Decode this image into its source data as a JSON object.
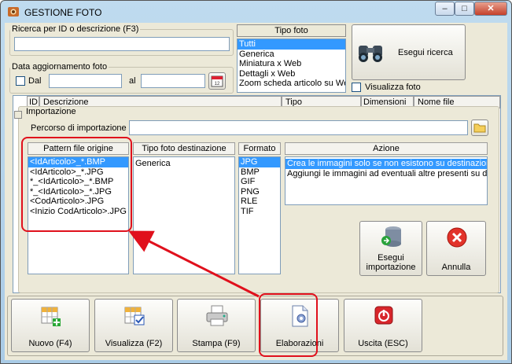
{
  "window": {
    "title": "GESTIONE FOTO",
    "controls": {
      "minimize": "–",
      "maximize": "□",
      "close": "✕"
    }
  },
  "search": {
    "legend": "Ricerca per ID o descrizione (F3)",
    "value": ""
  },
  "date": {
    "legend": "Data aggiornamento foto",
    "from_label": "Dal",
    "to_label": "al",
    "from_value": "",
    "to_value": ""
  },
  "tipo_foto": {
    "label": "Tipo foto",
    "items": [
      "Tutti",
      "Generica",
      "Miniatura x Web",
      "Dettagli x Web",
      "Zoom scheda articolo su Web"
    ],
    "selected": 0
  },
  "esegui_ricerca": {
    "label": "Esegui ricerca"
  },
  "visualizza_foto": {
    "label": "Visualizza foto",
    "checked": false
  },
  "grid_headers": [
    "ID",
    "Descrizione",
    "Tipo",
    "Dimensioni",
    "Nome file"
  ],
  "importazione": {
    "legend": "Importazione",
    "path_label": "Percorso di importazione :",
    "path_value": "",
    "pattern": {
      "header": "Pattern file origine",
      "items": [
        "<IdArticolo>_*.BMP",
        "<IdArticolo>_*.JPG",
        "*_<IdArticolo>_*.BMP",
        "*_<IdArticolo>_*.JPG",
        "<CodArticolo>.JPG",
        "<Inizio CodArticolo>.JPG"
      ],
      "selected": 0
    },
    "tipo_dest": {
      "header": "Tipo foto destinazione",
      "items": [
        "Generica"
      ]
    },
    "formato": {
      "header": "Formato",
      "items": [
        "JPG",
        "BMP",
        "GIF",
        "PNG",
        "RLE",
        "TIF"
      ],
      "selected": 0
    },
    "azione": {
      "header": "Azione",
      "items": [
        "Crea le immagini solo se non esistono su destinazione",
        "Aggiungi le immagini ad eventuali altre presenti su destinazione"
      ],
      "selected": 0
    },
    "esegui_importazione": {
      "label1": "Esegui",
      "label2": "importazione"
    },
    "annulla": {
      "label": "Annulla"
    }
  },
  "toolbar": {
    "nuovo": "Nuovo (F4)",
    "visualizza": "Visualizza (F2)",
    "stampa": "Stampa (F9)",
    "elaborazioni": "Elaborazioni",
    "uscita": "Uscita (ESC)"
  },
  "colors": {
    "highlight": "#e0101c",
    "selection": "#3399ff"
  }
}
